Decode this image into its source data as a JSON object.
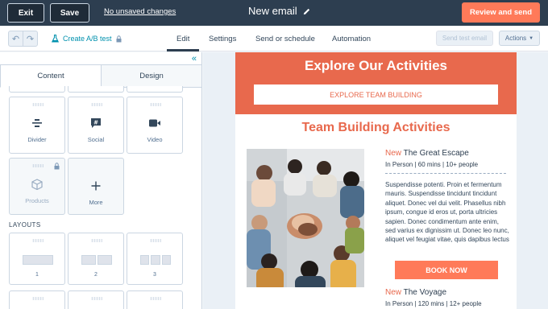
{
  "topbar": {
    "exit_label": "Exit",
    "save_label": "Save",
    "unsaved_label": "No unsaved changes",
    "email_name": "New email",
    "review_label": "Review and send",
    "accent_color": "#ff7a59"
  },
  "subnav": {
    "ab_test_label": "Create A/B test",
    "tabs": [
      {
        "label": "Edit"
      },
      {
        "label": "Settings"
      },
      {
        "label": "Send or schedule"
      },
      {
        "label": "Automation"
      }
    ],
    "active_tab": "Edit",
    "send_test_label": "Send test email",
    "actions_label": "Actions"
  },
  "sidebar": {
    "tabs": [
      {
        "label": "Content"
      },
      {
        "label": "Design"
      }
    ],
    "active_tab": "Content",
    "modules": [
      {
        "label": "Divider",
        "icon": "divider-icon"
      },
      {
        "label": "Social",
        "icon": "social-icon"
      },
      {
        "label": "Video",
        "icon": "video-icon"
      },
      {
        "label": "Products",
        "icon": "products-icon",
        "locked": true
      },
      {
        "label": "More",
        "icon": "plus-icon"
      }
    ],
    "layouts_heading": "LAYOUTS",
    "layouts": [
      {
        "label": "1"
      },
      {
        "label": "2"
      },
      {
        "label": "3"
      }
    ]
  },
  "email": {
    "hero_title": "Explore Our Activities",
    "hero_button": "EXPLORE TEAM BUILDING",
    "section_title": "Team Building Activities",
    "activity1": {
      "badge": "New",
      "name": "The Great Escape",
      "meta": "In Person | 60 mins | 10+ people",
      "description": "Suspendisse potenti. Proin et fermentum mauris. Suspendisse tincidunt tincidunt aliquet. Donec vel dui velit. Phasellus nibh ipsum, congue id eros ut, porta ultricies sapien. Donec condimentum ante enim, sed varius ex dignissim ut. Donec leo nunc, aliquet vel feugiat vitae, quis dapibus lectus",
      "button": "BOOK NOW"
    },
    "activity2": {
      "badge": "New",
      "name": "The Voyage",
      "meta": "In Person | 120 mins | 12+ people"
    },
    "brand_color": "#e8694d"
  }
}
